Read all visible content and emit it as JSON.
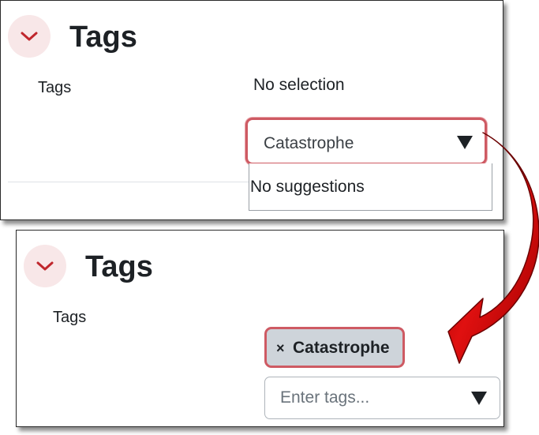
{
  "colors": {
    "accent": "#ce5a63",
    "arrow": "#c00000",
    "collapse_bg": "#f8e7e8",
    "chip_bg": "#ced4da",
    "text": "#1d2125"
  },
  "before": {
    "section_title": "Tags",
    "field_label": "Tags",
    "selection_status": "No selection",
    "input_value": "Catastrophe",
    "suggestions_text": "No suggestions",
    "collapse_icon": "chevron-down-icon",
    "dropdown_icon": "caret-down-icon"
  },
  "after": {
    "section_title": "Tags",
    "field_label": "Tags",
    "selected_tag": {
      "remove_symbol": "×",
      "label": "Catastrophe"
    },
    "input_placeholder": "Enter tags...",
    "collapse_icon": "chevron-down-icon",
    "dropdown_icon": "caret-down-icon"
  },
  "annotation": {
    "icon": "curved-arrow-icon"
  }
}
